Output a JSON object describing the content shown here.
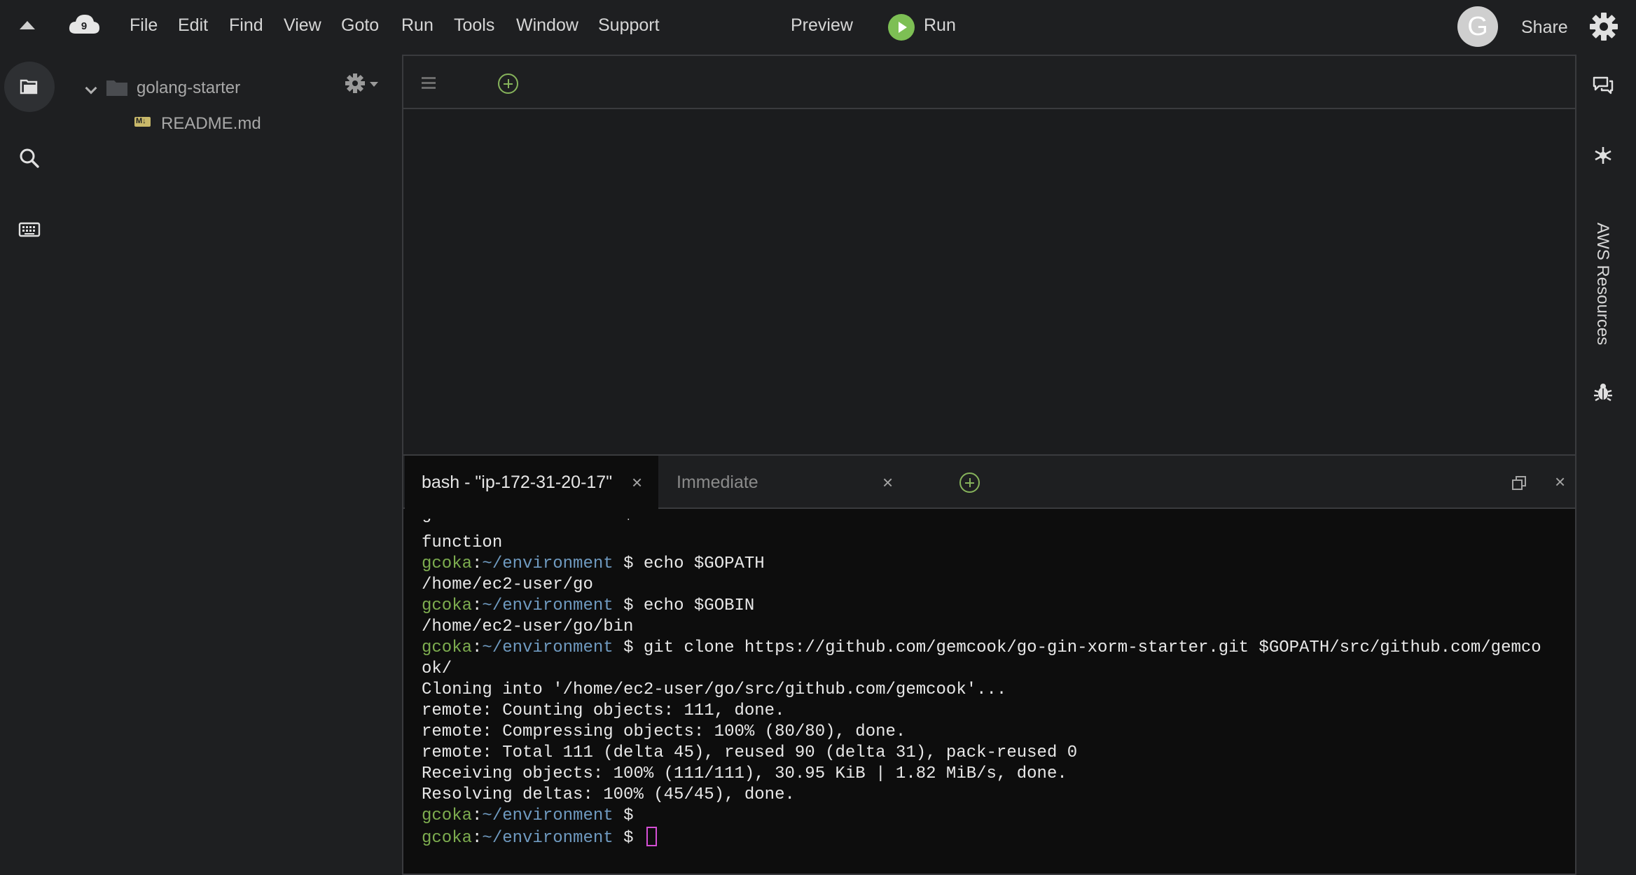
{
  "menubar": {
    "items": [
      {
        "label": "File"
      },
      {
        "label": "Edit"
      },
      {
        "label": "Find"
      },
      {
        "label": "View"
      },
      {
        "label": "Goto"
      },
      {
        "label": "Run"
      },
      {
        "label": "Tools"
      },
      {
        "label": "Window"
      },
      {
        "label": "Support"
      }
    ],
    "preview_label": "Preview",
    "run_label": "Run",
    "avatar_letter": "G",
    "share_label": "Share",
    "logo_badge": "9"
  },
  "filetree": {
    "folder": "golang-starter",
    "file": "README.md",
    "file_badge": "M↓"
  },
  "panel": {
    "tabs": [
      {
        "label": "bash - \"ip-172-31-20-17\"",
        "close": "×"
      },
      {
        "label": "Immediate",
        "close": "×"
      }
    ],
    "close": "×"
  },
  "terminal": {
    "user": "gcoka",
    "path": "~/environment",
    "prompt_symbol": "$",
    "clipped_line": "gcoka:~/environment $ . ~/.bashrc",
    "lines": [
      {
        "kind": "out",
        "text": "function"
      },
      {
        "kind": "cmd",
        "text": "echo $GOPATH"
      },
      {
        "kind": "out",
        "text": "/home/ec2-user/go"
      },
      {
        "kind": "cmd",
        "text": "echo $GOBIN"
      },
      {
        "kind": "out",
        "text": "/home/ec2-user/go/bin"
      },
      {
        "kind": "cmd",
        "text": "git clone https://github.com/gemcook/go-gin-xorm-starter.git $GOPATH/src/github.com/gemco"
      },
      {
        "kind": "out",
        "text": "ok/"
      },
      {
        "kind": "out",
        "text": "Cloning into '/home/ec2-user/go/src/github.com/gemcook'..."
      },
      {
        "kind": "out",
        "text": "remote: Counting objects: 111, done."
      },
      {
        "kind": "out",
        "text": "remote: Compressing objects: 100% (80/80), done."
      },
      {
        "kind": "out",
        "text": "remote: Total 111 (delta 45), reused 90 (delta 31), pack-reused 0"
      },
      {
        "kind": "out",
        "text": "Receiving objects: 100% (111/111), 30.95 KiB | 1.82 MiB/s, done."
      },
      {
        "kind": "out",
        "text": "Resolving deltas: 100% (45/45), done."
      },
      {
        "kind": "cmd",
        "text": ""
      },
      {
        "kind": "cmd",
        "text": "",
        "cursor": true
      }
    ]
  },
  "rightbar": {
    "aws_label": "AWS Resources"
  }
}
